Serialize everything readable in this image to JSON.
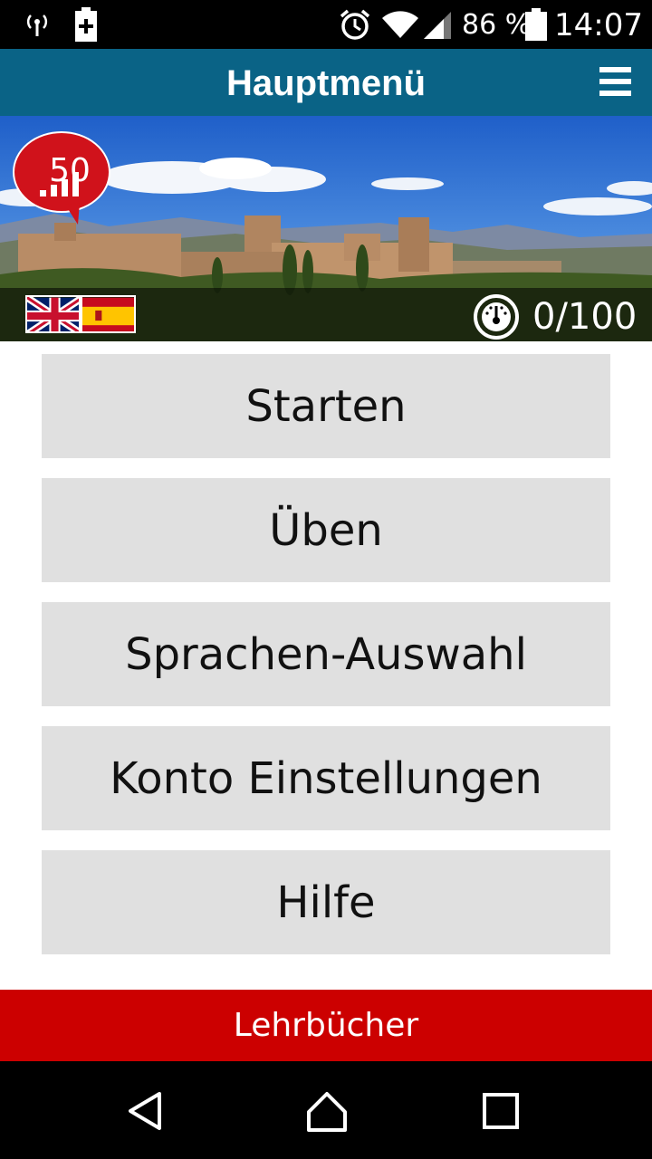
{
  "status_bar": {
    "battery_percent": "86 %",
    "time": "14:07",
    "icons": [
      "antenna-icon",
      "battery-charging-icon",
      "alarm-icon",
      "wifi-icon",
      "signal-icon",
      "battery-icon"
    ]
  },
  "app_bar": {
    "title": "Hauptmenü",
    "menu_icon": "hamburger-menu-icon"
  },
  "hero": {
    "level": "50",
    "languages": [
      "english-flag",
      "spanish-flag"
    ],
    "score": "0/100",
    "score_icon": "gauge-icon"
  },
  "menu": {
    "items": [
      {
        "label": "Starten"
      },
      {
        "label": "Üben"
      },
      {
        "label": "Sprachen-Auswahl"
      },
      {
        "label": "Konto Einstellungen"
      },
      {
        "label": "Hilfe"
      }
    ]
  },
  "banner": {
    "label": "Lehrbücher"
  },
  "nav_bar": {
    "icons": [
      "back-icon",
      "home-icon",
      "recents-icon"
    ]
  },
  "colors": {
    "app_bar": "#0a6386",
    "banner": "#cc0000",
    "menu_button": "#e0e0e0"
  }
}
